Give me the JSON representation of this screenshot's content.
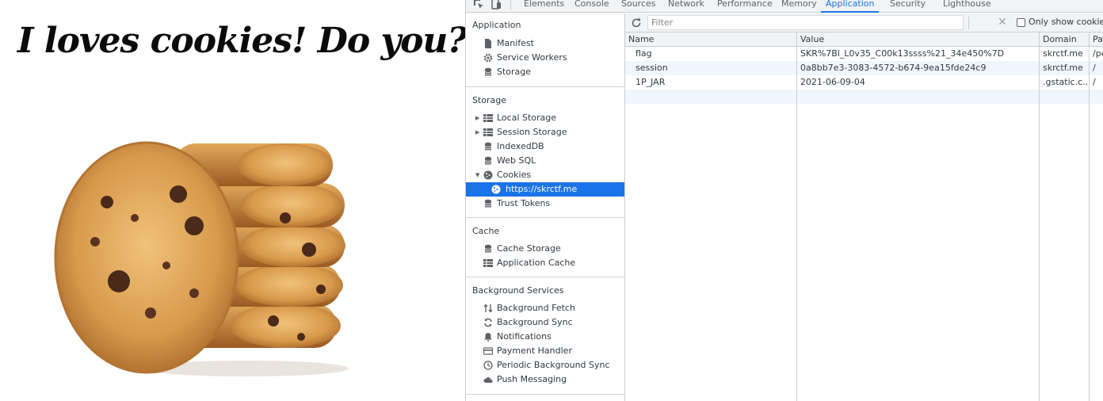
{
  "page": {
    "heading": "I loves cookies! Do you?"
  },
  "devtools": {
    "tabs": [
      "Elements",
      "Console",
      "Sources",
      "Network",
      "Performance",
      "Memory",
      "Application",
      "Security",
      "Lighthouse"
    ],
    "active_tab": "Application",
    "sidebar": {
      "application": {
        "title": "Application",
        "items": [
          {
            "label": "Manifest",
            "icon": "document-icon"
          },
          {
            "label": "Service Workers",
            "icon": "gear-icon"
          },
          {
            "label": "Storage",
            "icon": "database-icon"
          }
        ]
      },
      "storage": {
        "title": "Storage",
        "items": [
          {
            "label": "Local Storage",
            "icon": "grid-icon"
          },
          {
            "label": "Session Storage",
            "icon": "grid-icon"
          },
          {
            "label": "IndexedDB",
            "icon": "database-icon"
          },
          {
            "label": "Web SQL",
            "icon": "database-icon"
          },
          {
            "label": "Cookies",
            "icon": "cookie-icon"
          },
          {
            "label": "https://skrctf.me",
            "icon": "cookie-icon"
          },
          {
            "label": "Trust Tokens",
            "icon": "database-icon"
          }
        ]
      },
      "cache": {
        "title": "Cache",
        "items": [
          {
            "label": "Cache Storage",
            "icon": "database-icon"
          },
          {
            "label": "Application Cache",
            "icon": "grid-icon"
          }
        ]
      },
      "background_services": {
        "title": "Background Services",
        "items": [
          {
            "label": "Background Fetch",
            "icon": "arrows-icon"
          },
          {
            "label": "Background Sync",
            "icon": "sync-icon"
          },
          {
            "label": "Notifications",
            "icon": "bell-icon"
          },
          {
            "label": "Payment Handler",
            "icon": "card-icon"
          },
          {
            "label": "Periodic Background Sync",
            "icon": "clock-icon"
          },
          {
            "label": "Push Messaging",
            "icon": "cloud-icon"
          }
        ]
      }
    },
    "toolbar": {
      "filter_placeholder": "Filter",
      "only_issues_label": "Only show cookies w"
    },
    "cookie_table": {
      "columns": [
        "Name",
        "Value",
        "Domain",
        "Pat"
      ],
      "rows": [
        {
          "name": "flag",
          "value": "SKR%7Bl_L0v35_C00k13ssss%21_34e450%7D",
          "domain": "skrctf.me",
          "path": "/pc"
        },
        {
          "name": "session",
          "value": "0a8bb7e3-3083-4572-b674-9ea15fde24c9",
          "domain": "skrctf.me",
          "path": "/"
        },
        {
          "name": "1P_JAR",
          "value": "2021-06-09-04",
          "domain": ".gstatic.c...",
          "path": "/"
        }
      ]
    },
    "colors": {
      "accent": "#1a73e8",
      "selected_row": "#1a73e8",
      "alt_row": "#f0f6fe"
    }
  }
}
